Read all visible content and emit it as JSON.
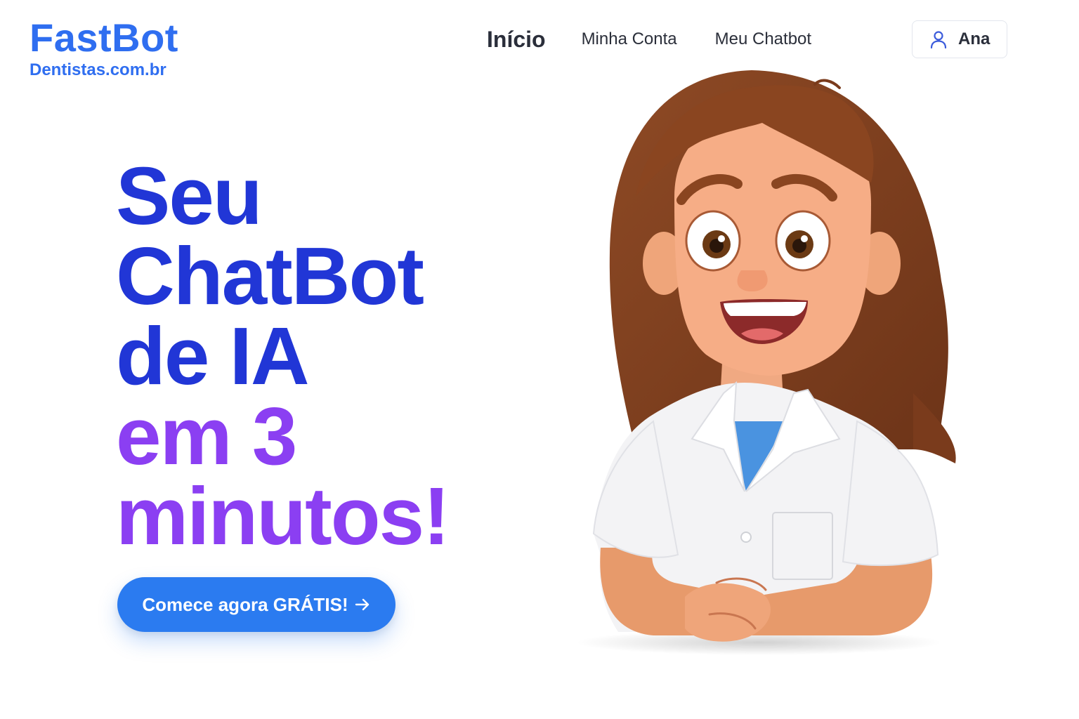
{
  "brand": {
    "name": "FastBot",
    "domain": "Dentistas.com.br",
    "color": "#2f6ef0"
  },
  "nav": {
    "items": [
      {
        "label": "Início",
        "active": true
      },
      {
        "label": "Minha Conta",
        "active": false
      },
      {
        "label": "Meu Chatbot",
        "active": false
      }
    ]
  },
  "user": {
    "name": "Ana",
    "icon": "user-icon"
  },
  "hero": {
    "line1": "Seu",
    "line2": "ChatBot",
    "line3": "de IA",
    "line4": "em 3",
    "line5": "minutos!",
    "primary_color": "#2136d6",
    "accent_color": "#8b3ff2"
  },
  "cta": {
    "label": "Comece agora GRÁTIS!",
    "icon": "arrow-right-icon",
    "color": "#2b7bf0"
  },
  "illustration": {
    "icon": "dentist-illustration"
  }
}
